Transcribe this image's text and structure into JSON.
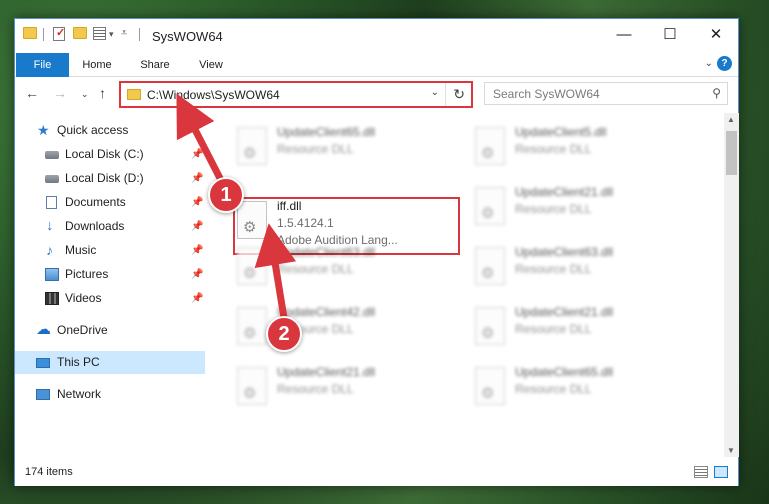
{
  "window": {
    "title": "SysWOW64",
    "controls": {
      "minimize": "—",
      "maximize": "☐",
      "close": "✕"
    }
  },
  "ribbon": {
    "tabs": [
      "File",
      "Home",
      "Share",
      "View"
    ],
    "help": "?"
  },
  "navigation": {
    "address": "C:\\Windows\\SysWOW64",
    "search_placeholder": "Search SysWOW64"
  },
  "sidebar": {
    "items": [
      {
        "label": "Quick access",
        "icon": "star-icon",
        "pinned": false
      },
      {
        "label": "Local Disk (C:)",
        "icon": "drive-icon",
        "pinned": true
      },
      {
        "label": "Local Disk (D:)",
        "icon": "drive-icon",
        "pinned": true
      },
      {
        "label": "Documents",
        "icon": "documents-icon",
        "pinned": true
      },
      {
        "label": "Downloads",
        "icon": "download-icon",
        "pinned": true
      },
      {
        "label": "Music",
        "icon": "music-icon",
        "pinned": true
      },
      {
        "label": "Pictures",
        "icon": "pictures-icon",
        "pinned": true
      },
      {
        "label": "Videos",
        "icon": "videos-icon",
        "pinned": true
      },
      {
        "label": "OneDrive",
        "icon": "onedrive-icon",
        "pinned": false
      },
      {
        "label": "This PC",
        "icon": "computer-icon",
        "pinned": false,
        "selected": true
      },
      {
        "label": "Network",
        "icon": "network-icon",
        "pinned": false
      }
    ]
  },
  "files": [
    {
      "name": "UpdateClient65.dll",
      "line2": "Resource DLL",
      "line3": "",
      "blurred": true
    },
    {
      "name": "UpdateClient5.dll",
      "line2": "Resource DLL",
      "line3": "",
      "blurred": true
    },
    {
      "name": "iff.dll",
      "line2": "1.5.4124.1",
      "line3": "Adobe Audition Lang...",
      "blurred": false
    },
    {
      "name": "UpdateClient21.dll",
      "line2": "Resource DLL",
      "line3": "",
      "blurred": true
    },
    {
      "name": "UpdateClient63.dll",
      "line2": "Resource DLL",
      "line3": "",
      "blurred": true
    },
    {
      "name": "UpdateClient63.dll",
      "line2": "Resource DLL",
      "line3": "",
      "blurred": true
    },
    {
      "name": "UpdateClient42.dll",
      "line2": "Resource DLL",
      "line3": "",
      "blurred": true
    },
    {
      "name": "UpdateClient21.dll",
      "line2": "Resource DLL",
      "line3": "",
      "blurred": true
    },
    {
      "name": "UpdateClient21.dll",
      "line2": "Resource DLL",
      "line3": "",
      "blurred": true
    },
    {
      "name": "UpdateClient65.dll",
      "line2": "Resource DLL",
      "line3": "",
      "blurred": true
    }
  ],
  "status": {
    "item_count": "174 items"
  },
  "annotations": {
    "badge1": "1",
    "badge2": "2",
    "color": "#d9363e"
  }
}
